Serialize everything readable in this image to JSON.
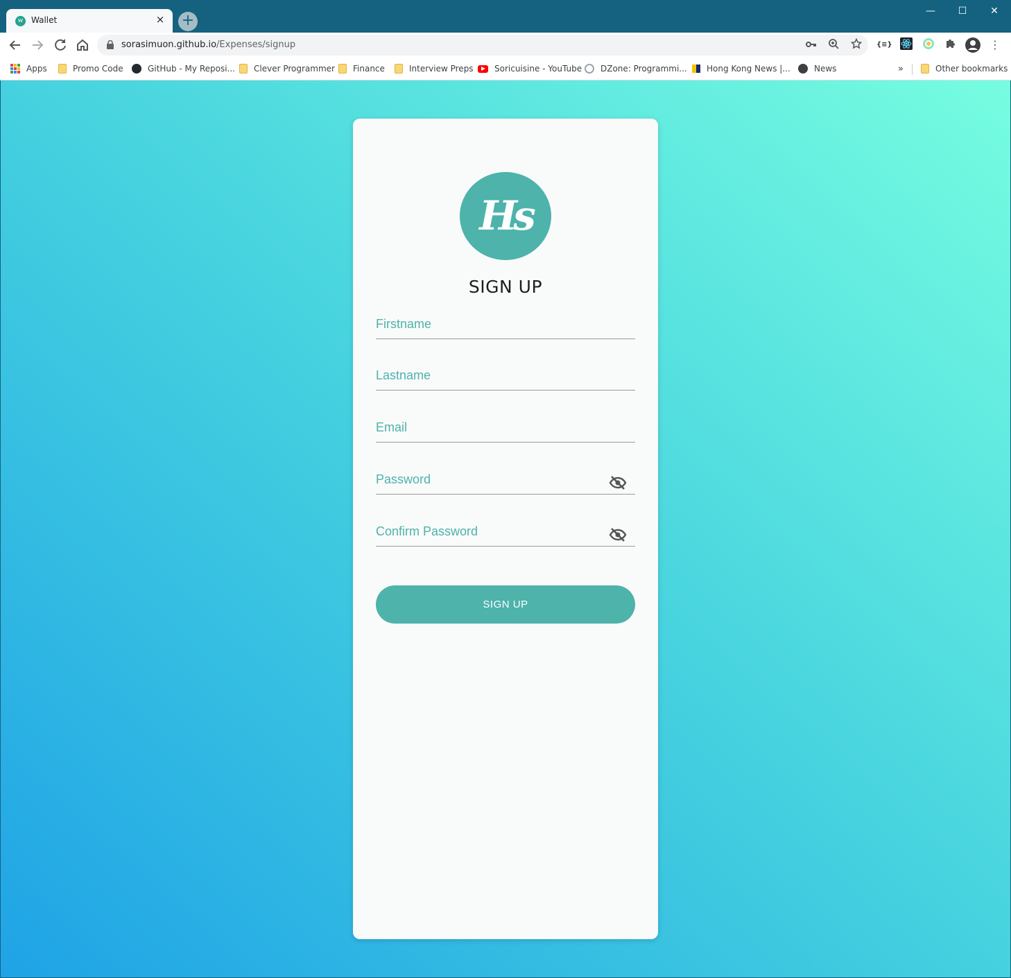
{
  "browser": {
    "tab": {
      "title": "Wallet",
      "favicon_letter": "w"
    },
    "new_tab_symbol": "+",
    "window_controls": {
      "minimize": "—",
      "maximize": "☐",
      "close": "✕"
    },
    "url": {
      "host": "sorasimuon.github.io",
      "path": "/Expenses/signup"
    },
    "bookmarks": [
      {
        "label": "Apps",
        "icon": "apps-grid-icon"
      },
      {
        "label": "Promo Code",
        "icon": "folder-icon"
      },
      {
        "label": "GitHub - My Reposi...",
        "icon": "github-icon"
      },
      {
        "label": "Clever Programmer",
        "icon": "folder-icon"
      },
      {
        "label": "Finance",
        "icon": "folder-icon"
      },
      {
        "label": "Interview Preps",
        "icon": "folder-icon"
      },
      {
        "label": "Soricuisine - YouTube",
        "icon": "youtube-icon"
      },
      {
        "label": "DZone: Programmi...",
        "icon": "dzone-icon"
      },
      {
        "label": "Hong Kong News |...",
        "icon": "hk-news-icon"
      },
      {
        "label": "News",
        "icon": "globe-icon"
      }
    ],
    "bookmarks_overflow": "»",
    "other_bookmarks": "Other bookmarks"
  },
  "page": {
    "logo_text": "Hs",
    "heading": "SIGN UP",
    "fields": {
      "firstname": {
        "placeholder": "Firstname",
        "value": ""
      },
      "lastname": {
        "placeholder": "Lastname",
        "value": ""
      },
      "email": {
        "placeholder": "Email",
        "value": ""
      },
      "password": {
        "placeholder": "Password",
        "value": ""
      },
      "confirm_password": {
        "placeholder": "Confirm Password",
        "value": ""
      }
    },
    "submit_label": "SIGN UP"
  },
  "colors": {
    "accent": "#4db3ab",
    "gradient_start": "#1fa3e6",
    "gradient_end": "#76fde0",
    "titlebar": "#14627f"
  }
}
